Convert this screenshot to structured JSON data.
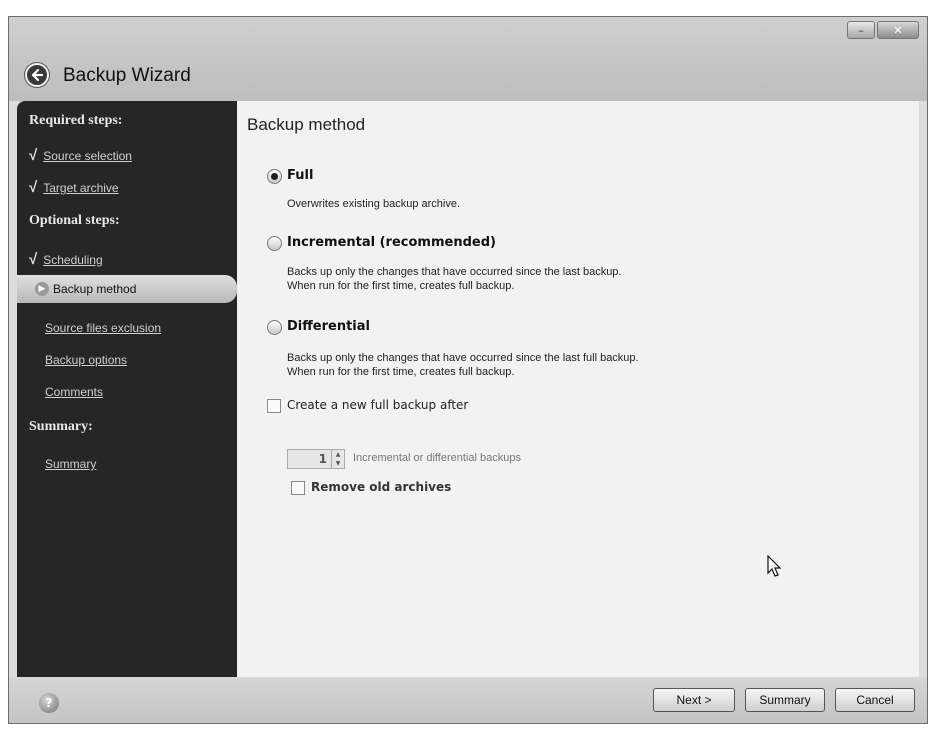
{
  "window": {
    "title": "Backup Wizard",
    "minimize_glyph": "–",
    "close_glyph": "✕"
  },
  "sidebar": {
    "required_header": "Required steps:",
    "optional_header": "Optional steps:",
    "summary_header": "Summary:",
    "items": [
      {
        "label": "Source selection",
        "done": true
      },
      {
        "label": "Target archive",
        "done": true
      },
      {
        "label": "Scheduling",
        "done": true
      },
      {
        "label": "Backup method",
        "active": true
      },
      {
        "label": "Source files exclusion"
      },
      {
        "label": "Backup options"
      },
      {
        "label": "Comments"
      },
      {
        "label": "Summary"
      }
    ],
    "check_glyph": "√"
  },
  "main": {
    "title": "Backup method",
    "options": [
      {
        "label": "Full",
        "selected": true,
        "desc1": "Overwrites existing backup archive.",
        "desc2": ""
      },
      {
        "label": "Incremental (recommended)",
        "selected": false,
        "desc1": "Backs up only the changes that have occurred since the last backup.",
        "desc2": "When run for the first time, creates full backup."
      },
      {
        "label": "Differential",
        "selected": false,
        "desc1": "Backs up only the changes that have occurred since the last full backup.",
        "desc2": "When run for the first time, creates full backup."
      }
    ],
    "create_new_full_label": "Create a new full backup after",
    "stepper_value": "1",
    "stepper_label": "Incremental or differential backups",
    "remove_old_label": "Remove old archives"
  },
  "footer": {
    "help_glyph": "?",
    "next_label": "Next >",
    "summary_label": "Summary",
    "cancel_label": "Cancel"
  },
  "icons": {
    "back": "back-arrow-icon",
    "help": "help-icon",
    "active_step": "arrow-right-icon",
    "cursor": "mouse-pointer-icon"
  }
}
